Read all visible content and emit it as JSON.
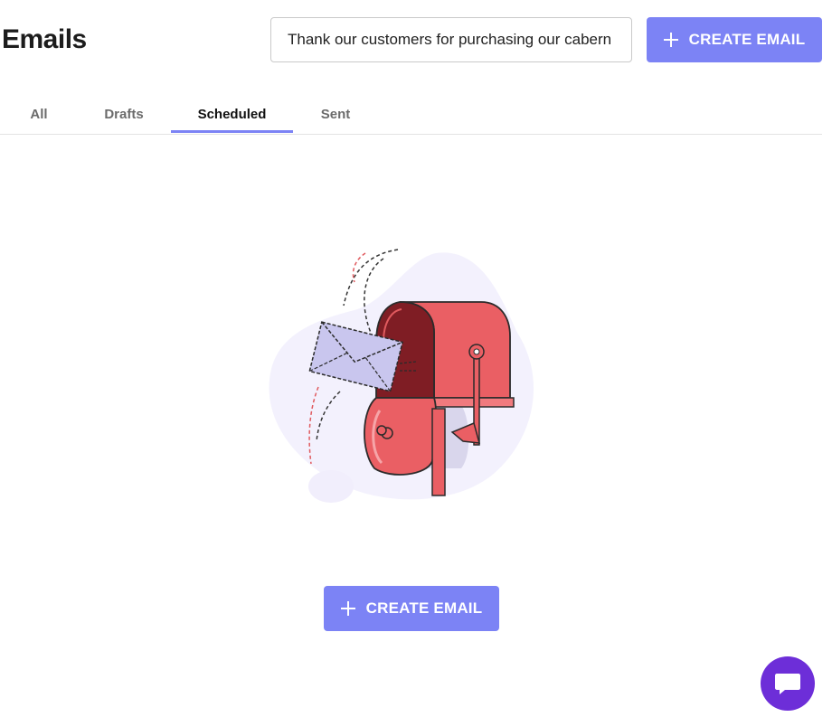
{
  "header": {
    "title": "Emails",
    "prompt_value": "Thank our customers for purchasing our cabern",
    "create_label": "CREATE EMAIL"
  },
  "tabs": [
    {
      "label": "All",
      "active": false
    },
    {
      "label": "Drafts",
      "active": false
    },
    {
      "label": "Scheduled",
      "active": true
    },
    {
      "label": "Sent",
      "active": false
    }
  ],
  "empty_state": {
    "illustration": "mailbox-illustration",
    "create_label": "CREATE EMAIL"
  },
  "chat_widget": {
    "icon": "chat-bubble-icon"
  },
  "colors": {
    "accent": "#7c83f5",
    "chat": "#6d2ed8",
    "mailbox": "#e95f64"
  }
}
